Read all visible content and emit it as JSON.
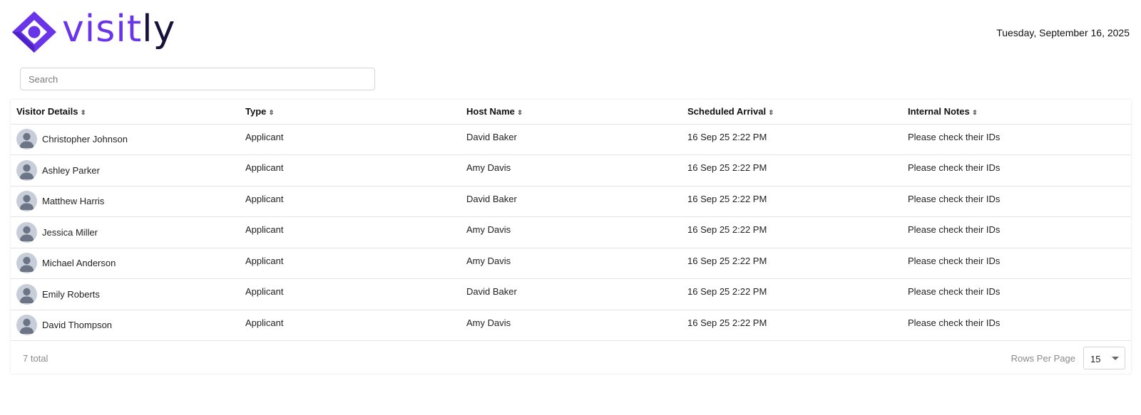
{
  "brand": {
    "logo_part1": "visit",
    "logo_part2": "ly",
    "primary_color": "#6a35e8",
    "dark_color": "#16123a"
  },
  "header": {
    "date": "Tuesday, September 16, 2025"
  },
  "search": {
    "placeholder": "Search"
  },
  "table": {
    "columns": [
      {
        "label": "Visitor Details"
      },
      {
        "label": "Type"
      },
      {
        "label": "Host Name"
      },
      {
        "label": "Scheduled Arrival"
      },
      {
        "label": "Internal Notes"
      }
    ],
    "rows": [
      {
        "visitor": "Christopher Johnson",
        "type": "Applicant",
        "host": "David Baker",
        "arrival": "16 Sep 25 2:22 PM",
        "notes": "Please check their IDs"
      },
      {
        "visitor": "Ashley Parker",
        "type": "Applicant",
        "host": "Amy Davis",
        "arrival": "16 Sep 25 2:22 PM",
        "notes": "Please check their IDs"
      },
      {
        "visitor": "Matthew Harris",
        "type": "Applicant",
        "host": "David Baker",
        "arrival": "16 Sep 25 2:22 PM",
        "notes": "Please check their IDs"
      },
      {
        "visitor": "Jessica Miller",
        "type": "Applicant",
        "host": "Amy Davis",
        "arrival": "16 Sep 25 2:22 PM",
        "notes": "Please check their IDs"
      },
      {
        "visitor": "Michael Anderson",
        "type": "Applicant",
        "host": "Amy Davis",
        "arrival": "16 Sep 25 2:22 PM",
        "notes": "Please check their IDs"
      },
      {
        "visitor": "Emily Roberts",
        "type": "Applicant",
        "host": "David Baker",
        "arrival": "16 Sep 25 2:22 PM",
        "notes": "Please check their IDs"
      },
      {
        "visitor": "David Thompson",
        "type": "Applicant",
        "host": "Amy Davis",
        "arrival": "16 Sep 25 2:22 PM",
        "notes": "Please check their IDs"
      }
    ]
  },
  "footer": {
    "total": "7 total",
    "rows_per_page_label": "Rows Per Page",
    "rows_per_page_value": "15"
  }
}
